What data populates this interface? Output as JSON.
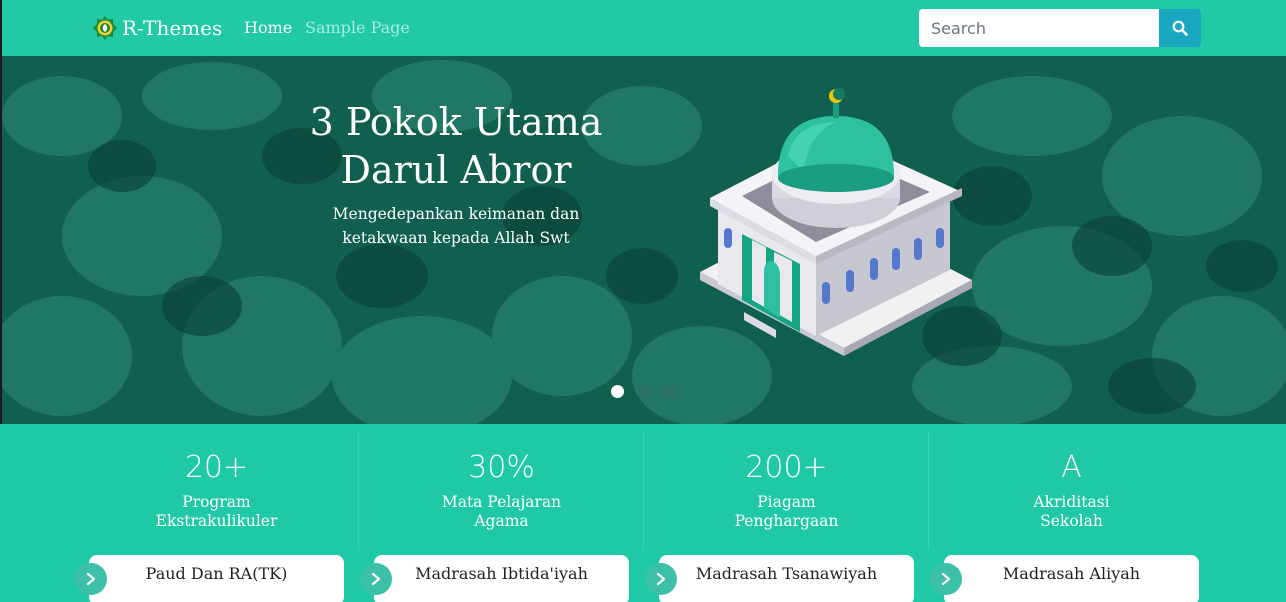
{
  "navbar": {
    "brand": "R-Themes",
    "links": [
      {
        "label": "Home",
        "active": true
      },
      {
        "label": "Sample Page",
        "active": false
      }
    ],
    "search_placeholder": "Search",
    "accent_color": "#21c9a4",
    "search_button_color": "#1aa7c0",
    "icons": {
      "logo": "leaf-emblem-icon",
      "search": "search-icon"
    }
  },
  "hero": {
    "title_line1": "3 Pokok Utama",
    "title_line2": "Darul Abror",
    "subtitle_line1": "Mengedepankan keimanan dan",
    "subtitle_line2": "ketakwaan kepada Allah Swt",
    "slides_count": 3,
    "active_slide": 1,
    "illustration": "mosque-icon"
  },
  "stats": [
    {
      "value": "20+",
      "label_line1": "Program",
      "label_line2": "Ekstrakulikuler"
    },
    {
      "value": "30%",
      "label_line1": "Mata Pelajaran",
      "label_line2": "Agama"
    },
    {
      "value": "200+",
      "label_line1": "Piagam",
      "label_line2": "Penghargaan"
    },
    {
      "value": "A",
      "label_line1": "Akriditasi",
      "label_line2": "Sekolah"
    }
  ],
  "levels": [
    {
      "label": "Paud Dan RA(TK)",
      "icon": "chevron-right-icon"
    },
    {
      "label": "Madrasah Ibtida'iyah",
      "icon": "chevron-right-icon"
    },
    {
      "label": "Madrasah Tsanawiyah",
      "icon": "chevron-right-icon"
    },
    {
      "label": "Madrasah Aliyah",
      "icon": "chevron-right-icon"
    }
  ]
}
